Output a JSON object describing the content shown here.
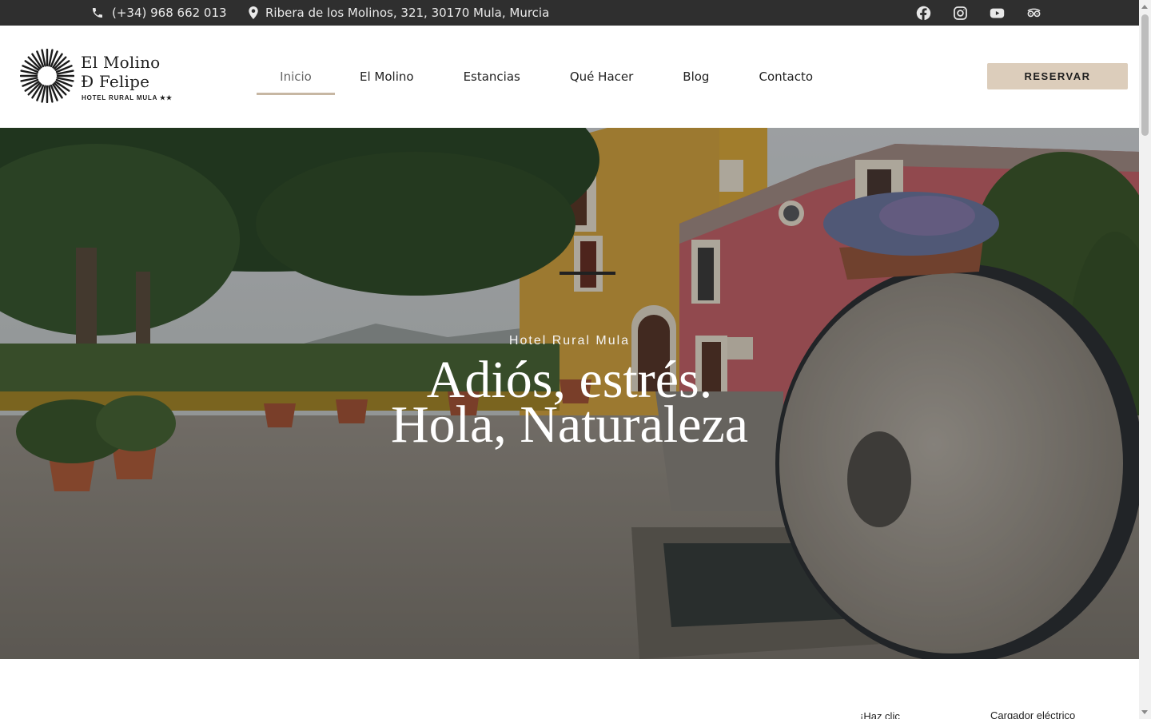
{
  "topbar": {
    "phone": "(+34) 968 662 013",
    "phone_icon": "phone-icon",
    "address": "Ribera de los Molinos, 321, 30170 Mula, Murcia",
    "address_icon": "map-pin-icon",
    "socials": [
      {
        "icon": "facebook-icon"
      },
      {
        "icon": "instagram-icon"
      },
      {
        "icon": "youtube-icon"
      },
      {
        "icon": "tripadvisor-icon"
      }
    ]
  },
  "header": {
    "logo": {
      "line1": "El Molino",
      "line2": "Đ Felipe",
      "tagline": "HOTEL RURAL MULA ★★"
    },
    "nav": [
      {
        "label": "Inicio",
        "active": true
      },
      {
        "label": "El Molino",
        "active": false
      },
      {
        "label": "Estancias",
        "active": false
      },
      {
        "label": "Qué Hacer",
        "active": false
      },
      {
        "label": "Blog",
        "active": false
      },
      {
        "label": "Contacto",
        "active": false
      }
    ],
    "cta": "RESERVAR"
  },
  "hero": {
    "kicker": "Hotel Rural Mula",
    "title_line1": "Adiós, estrés.",
    "title_line2": "Hola, Naturaleza"
  },
  "below": {
    "link1": "¡Haz clic",
    "link2": "Cargador eléctrico"
  },
  "colors": {
    "topbar_bg": "#2f2f2f",
    "accent": "#c7b7a3",
    "cta_bg": "#dccdbb"
  }
}
